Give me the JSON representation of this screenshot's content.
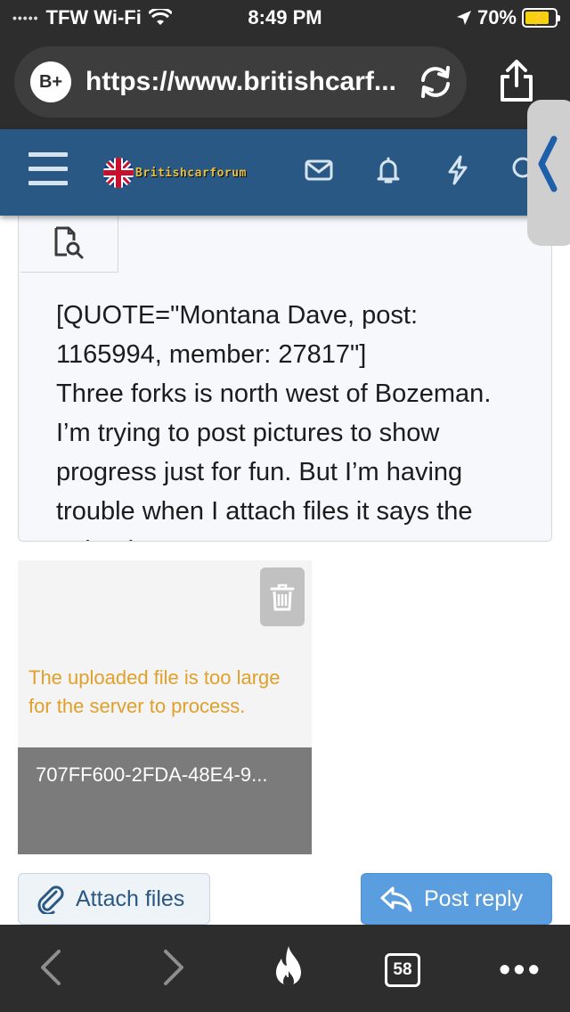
{
  "status_bar": {
    "signal": "•••••",
    "carrier": "TFW Wi-Fi",
    "time": "8:49 PM",
    "battery_percent": "70%"
  },
  "browser": {
    "site_badge": "B+",
    "url": "https://www.britishcarf..."
  },
  "site_header": {
    "logo_text": "Britishcarforum",
    "icons": [
      "menu-icon",
      "mail-icon",
      "bell-icon",
      "bolt-icon",
      "search-icon"
    ],
    "colors": {
      "header_bg": "#2a5885"
    }
  },
  "editor": {
    "text": "[QUOTE=\"Montana Dave, post: 1165994, member: 27817\"]\nThree forks is north west of Bozeman. I’m trying to post pictures to show progress just for fun. But I’m having trouble when I attach files it says the upload"
  },
  "attachment": {
    "error": "The uploaded file is too large for the server to process.",
    "filename": "707FF600-2FDA-48E4-9...",
    "error_color": "#e0a02a"
  },
  "actions": {
    "attach_label": "Attach files",
    "post_label": "Post reply",
    "post_color": "#5a9ee0"
  },
  "bottom_bar": {
    "tab_count": "58"
  }
}
